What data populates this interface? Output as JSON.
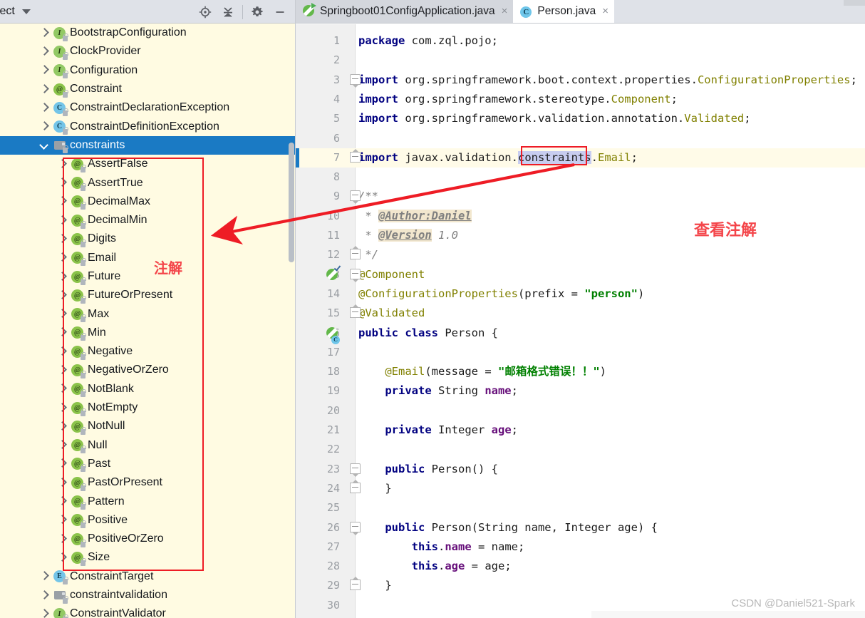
{
  "sidebar": {
    "panel_title": "oject",
    "caret_icon": "chevron-down-icon",
    "tools": [
      {
        "name": "locate-icon",
        "title": "Select Opened File"
      },
      {
        "name": "collapse-all-icon",
        "title": "Collapse All"
      },
      {
        "name": "gear-icon",
        "title": "Settings"
      },
      {
        "name": "minimize-icon",
        "title": "Hide"
      }
    ],
    "note_text": "注解",
    "note_color": "#f4454a",
    "highlight_box_color": "#ee1c25",
    "selected_color": "#1a7ac4",
    "background_color": "#fffbe2",
    "items": [
      {
        "label": "BootstrapConfiguration",
        "icon": "interface-icon",
        "indent": 2,
        "arrow": "right",
        "selected": false,
        "boxed": false
      },
      {
        "label": "ClockProvider",
        "icon": "interface-icon",
        "indent": 2,
        "arrow": "right",
        "selected": false,
        "boxed": false
      },
      {
        "label": "Configuration",
        "icon": "interface-icon",
        "indent": 2,
        "arrow": "right",
        "selected": false,
        "boxed": false
      },
      {
        "label": "Constraint",
        "icon": "annotation-icon",
        "indent": 2,
        "arrow": "right",
        "selected": false,
        "boxed": false
      },
      {
        "label": "ConstraintDeclarationException",
        "icon": "class-icon",
        "indent": 2,
        "arrow": "right",
        "selected": false,
        "boxed": false
      },
      {
        "label": "ConstraintDefinitionException",
        "icon": "class-icon",
        "indent": 2,
        "arrow": "right",
        "selected": false,
        "boxed": false
      },
      {
        "label": "constraints",
        "icon": "package-icon",
        "indent": 2,
        "arrow": "down",
        "selected": true,
        "boxed": false
      },
      {
        "label": "AssertFalse",
        "icon": "annotation-icon",
        "indent": 3,
        "arrow": "right",
        "selected": false,
        "boxed": true
      },
      {
        "label": "AssertTrue",
        "icon": "annotation-icon",
        "indent": 3,
        "arrow": "right",
        "selected": false,
        "boxed": true
      },
      {
        "label": "DecimalMax",
        "icon": "annotation-icon",
        "indent": 3,
        "arrow": "right",
        "selected": false,
        "boxed": true
      },
      {
        "label": "DecimalMin",
        "icon": "annotation-icon",
        "indent": 3,
        "arrow": "right",
        "selected": false,
        "boxed": true
      },
      {
        "label": "Digits",
        "icon": "annotation-icon",
        "indent": 3,
        "arrow": "right",
        "selected": false,
        "boxed": true
      },
      {
        "label": "Email",
        "icon": "annotation-icon",
        "indent": 3,
        "arrow": "right",
        "selected": false,
        "boxed": true
      },
      {
        "label": "Future",
        "icon": "annotation-icon",
        "indent": 3,
        "arrow": "right",
        "selected": false,
        "boxed": true
      },
      {
        "label": "FutureOrPresent",
        "icon": "annotation-icon",
        "indent": 3,
        "arrow": "right",
        "selected": false,
        "boxed": true
      },
      {
        "label": "Max",
        "icon": "annotation-icon",
        "indent": 3,
        "arrow": "right",
        "selected": false,
        "boxed": true
      },
      {
        "label": "Min",
        "icon": "annotation-icon",
        "indent": 3,
        "arrow": "right",
        "selected": false,
        "boxed": true
      },
      {
        "label": "Negative",
        "icon": "annotation-icon",
        "indent": 3,
        "arrow": "right",
        "selected": false,
        "boxed": true
      },
      {
        "label": "NegativeOrZero",
        "icon": "annotation-icon",
        "indent": 3,
        "arrow": "right",
        "selected": false,
        "boxed": true
      },
      {
        "label": "NotBlank",
        "icon": "annotation-icon",
        "indent": 3,
        "arrow": "right",
        "selected": false,
        "boxed": true
      },
      {
        "label": "NotEmpty",
        "icon": "annotation-icon",
        "indent": 3,
        "arrow": "right",
        "selected": false,
        "boxed": true
      },
      {
        "label": "NotNull",
        "icon": "annotation-icon",
        "indent": 3,
        "arrow": "right",
        "selected": false,
        "boxed": true
      },
      {
        "label": "Null",
        "icon": "annotation-icon",
        "indent": 3,
        "arrow": "right",
        "selected": false,
        "boxed": true
      },
      {
        "label": "Past",
        "icon": "annotation-icon",
        "indent": 3,
        "arrow": "right",
        "selected": false,
        "boxed": true
      },
      {
        "label": "PastOrPresent",
        "icon": "annotation-icon",
        "indent": 3,
        "arrow": "right",
        "selected": false,
        "boxed": true
      },
      {
        "label": "Pattern",
        "icon": "annotation-icon",
        "indent": 3,
        "arrow": "right",
        "selected": false,
        "boxed": true
      },
      {
        "label": "Positive",
        "icon": "annotation-icon",
        "indent": 3,
        "arrow": "right",
        "selected": false,
        "boxed": true
      },
      {
        "label": "PositiveOrZero",
        "icon": "annotation-icon",
        "indent": 3,
        "arrow": "right",
        "selected": false,
        "boxed": true
      },
      {
        "label": "Size",
        "icon": "annotation-icon",
        "indent": 3,
        "arrow": "right",
        "selected": false,
        "boxed": true
      },
      {
        "label": "ConstraintTarget",
        "icon": "enum-icon",
        "indent": 2,
        "arrow": "right",
        "selected": false,
        "boxed": false
      },
      {
        "label": "constraintvalidation",
        "icon": "package-icon",
        "indent": 2,
        "arrow": "right",
        "selected": false,
        "boxed": false
      },
      {
        "label": "ConstraintValidator",
        "icon": "interface-icon",
        "indent": 2,
        "arrow": "right",
        "selected": false,
        "boxed": false
      }
    ]
  },
  "editor": {
    "tabs": [
      {
        "label": "Springboot01ConfigApplication.java",
        "icon": "spring-run-icon",
        "active": false,
        "close": "×"
      },
      {
        "label": "Person.java",
        "icon": "java-class-icon",
        "active": true,
        "close": "×"
      }
    ],
    "note_text": "查看注解",
    "note_color": "#f4454a",
    "highlight_box_color": "#ee1c25",
    "selection_token": "constraints",
    "watermark": "CSDN @Daniel521-Spark",
    "lines": [
      {
        "n": "1"
      },
      {
        "n": "2"
      },
      {
        "n": "3"
      },
      {
        "n": "4"
      },
      {
        "n": "5"
      },
      {
        "n": "6"
      },
      {
        "n": "7"
      },
      {
        "n": "8"
      },
      {
        "n": "9"
      },
      {
        "n": "10"
      },
      {
        "n": "11"
      },
      {
        "n": "12"
      },
      {
        "n": "13"
      },
      {
        "n": "14"
      },
      {
        "n": "15"
      },
      {
        "n": "16"
      },
      {
        "n": "17"
      },
      {
        "n": "18"
      },
      {
        "n": "19"
      },
      {
        "n": "20"
      },
      {
        "n": "21"
      },
      {
        "n": "22"
      },
      {
        "n": "23"
      },
      {
        "n": "24"
      },
      {
        "n": "25"
      },
      {
        "n": "26"
      },
      {
        "n": "27"
      },
      {
        "n": "28"
      },
      {
        "n": "29"
      },
      {
        "n": "30"
      }
    ],
    "source": {
      "l1": "package com.zql.pojo;",
      "l3": "import org.springframework.boot.context.properties.ConfigurationProperties;",
      "l4": "import org.springframework.stereotype.Component;",
      "l5": "import org.springframework.validation.annotation.Validated;",
      "l7": "import javax.validation.constraints.Email;",
      "l9": "/**",
      "l10": " * @Author:Daniel",
      "l11": " * @Version 1.0",
      "l12": " */",
      "l13": "@Component",
      "l14": "@ConfigurationProperties(prefix = \"person\")",
      "l15": "@Validated",
      "l16": "public class Person {",
      "l18": "    @Email(message = \"邮箱格式错误！！\")",
      "l19": "    private String name;",
      "l21": "    private Integer age;",
      "l23": "    public Person() {",
      "l24": "    }",
      "l26": "    public Person(String name, Integer age) {",
      "l27": "        this.name = name;",
      "l28": "        this.age = age;",
      "l29": "    }"
    },
    "tokens": {
      "kw_package": "package",
      "kw_import": "import",
      "kw_public": "public",
      "kw_class": "class",
      "kw_private": "private",
      "kw_this": "this",
      "pkg_path": " com.zql.pojo;",
      "imp3_a": " org.springframework.boot.context.properties.",
      "imp3_b": "ConfigurationProperties",
      "imp4_a": " org.springframework.stereotype.",
      "imp4_b": "Component",
      "imp5_a": " org.springframework.validation.annotation.",
      "imp5_b": "Validated",
      "imp7_a": " javax.validation.",
      "imp7_b": "constraints",
      "imp7_c": ".Email;",
      "doc_open": "/**",
      "doc_star": " * ",
      "doc_author": "@Author:Daniel",
      "doc_version": "@Version",
      "doc_versionval": " 1.0",
      "doc_close": " */",
      "ann_component": "@Component",
      "ann_configprops": "@ConfigurationProperties",
      "configprops_open": "(prefix = ",
      "configprops_val": "\"person\"",
      "configprops_close": ")",
      "ann_validated": "@Validated",
      "class_decl_name": " Person {",
      "ann_email": "@Email",
      "email_open": "(message = ",
      "email_val": "\"邮箱格式错误！！\"",
      "email_close": ")",
      "field_name_type": " String ",
      "field_name": "name",
      "semi": ";",
      "field_age_type": " Integer ",
      "field_age": "age",
      "ctor0": " Person() {",
      "brace_close": "}",
      "ctor1": " Person(String name, Integer age) {",
      "assign_name": " = name;",
      "assign_age": " = age;",
      "dot_name": ".name",
      "dot_age": ".age"
    }
  }
}
